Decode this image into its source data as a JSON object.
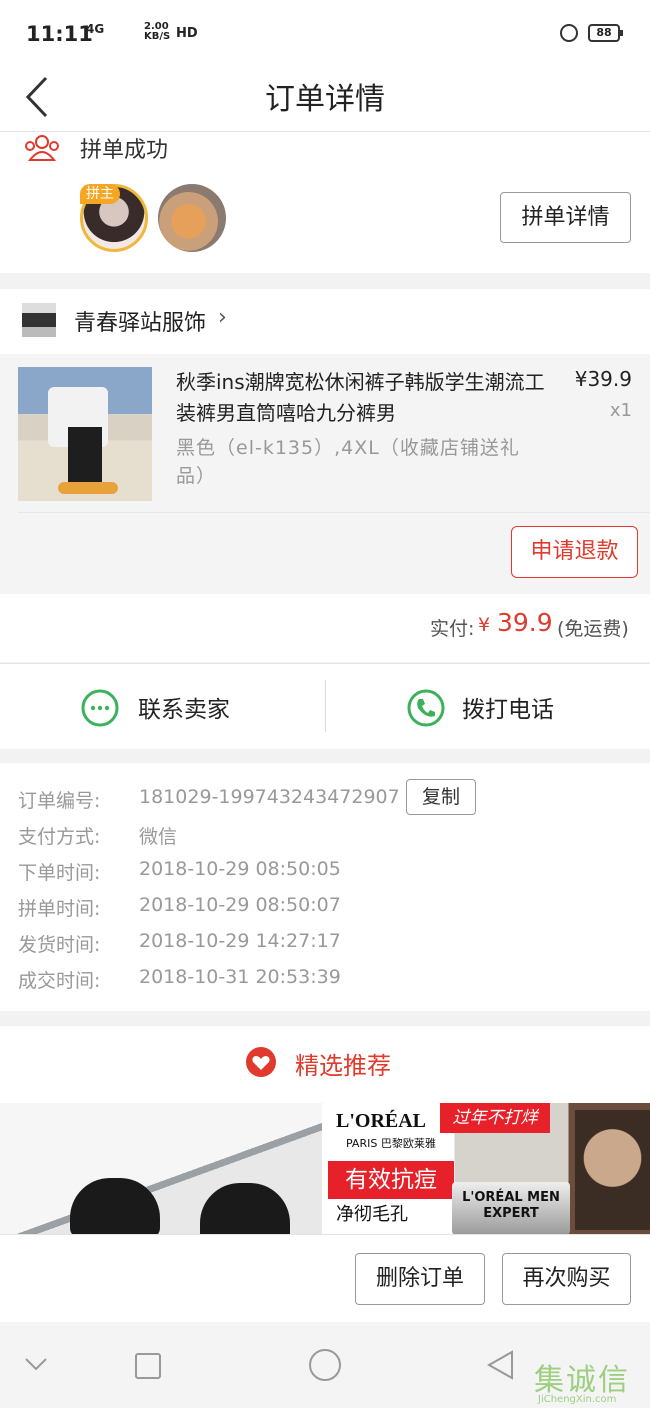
{
  "status_bar": {
    "time": "11:11",
    "signal": "4G",
    "speed_value": "2.00",
    "speed_unit": "KB/S",
    "hd": "HD",
    "battery": "88"
  },
  "nav": {
    "title": "订单详情",
    "back_icon": "chevron-left-icon"
  },
  "group": {
    "status": "拼单成功",
    "host_badge": "拼主",
    "detail_button": "拼单详情",
    "icon": "group-people-icon"
  },
  "shop": {
    "name": "青春驿站服饰",
    "item": {
      "title": "秋季ins潮牌宽松休闲裤子韩版学生潮流工装裤男直筒嘻哈九分裤男",
      "price": "¥39.9",
      "quantity": "x1",
      "spec": "黑色（el-k135）,4XL（收藏店铺送礼品）"
    },
    "refund_button": "申请退款",
    "paid_label": "实付:",
    "paid_currency": "¥",
    "paid_amount": "39.9",
    "shipping_note": "(免运费)"
  },
  "contact": {
    "seller_label": "联系卖家",
    "phone_label": "拨打电话",
    "chat_icon": "chat-bubble-icon",
    "phone_icon": "phone-icon"
  },
  "order_info": {
    "copy_button": "复制",
    "rows": [
      {
        "label": "订单编号:",
        "value": "181029-199743243472907"
      },
      {
        "label": "支付方式:",
        "value": "微信"
      },
      {
        "label": "下单时间:",
        "value": "2018-10-29 08:50:05"
      },
      {
        "label": "拼单时间:",
        "value": "2018-10-29 08:50:07"
      },
      {
        "label": "发货时间:",
        "value": "2018-10-29 14:27:17"
      },
      {
        "label": "成交时间:",
        "value": "2018-10-31 20:53:39"
      }
    ]
  },
  "recommend": {
    "title": "精选推荐",
    "icon": "heart-icon",
    "ad": {
      "brand": "L'ORÉAL",
      "brand_sub": "PARIS 巴黎欧莱雅",
      "tag": "过年不打烊",
      "headline": "有效抗痘",
      "subline": "净彻毛孔",
      "product": "L'ORÉAL MEN EXPERT"
    }
  },
  "actions": {
    "delete_button": "删除订单",
    "rebuy_button": "再次购买"
  },
  "watermark": {
    "text": "集诚信",
    "sub": "JiChengXin.com"
  },
  "colors": {
    "accent": "#e03a2d",
    "green": "#3bb25a",
    "badge": "#f5a623"
  }
}
